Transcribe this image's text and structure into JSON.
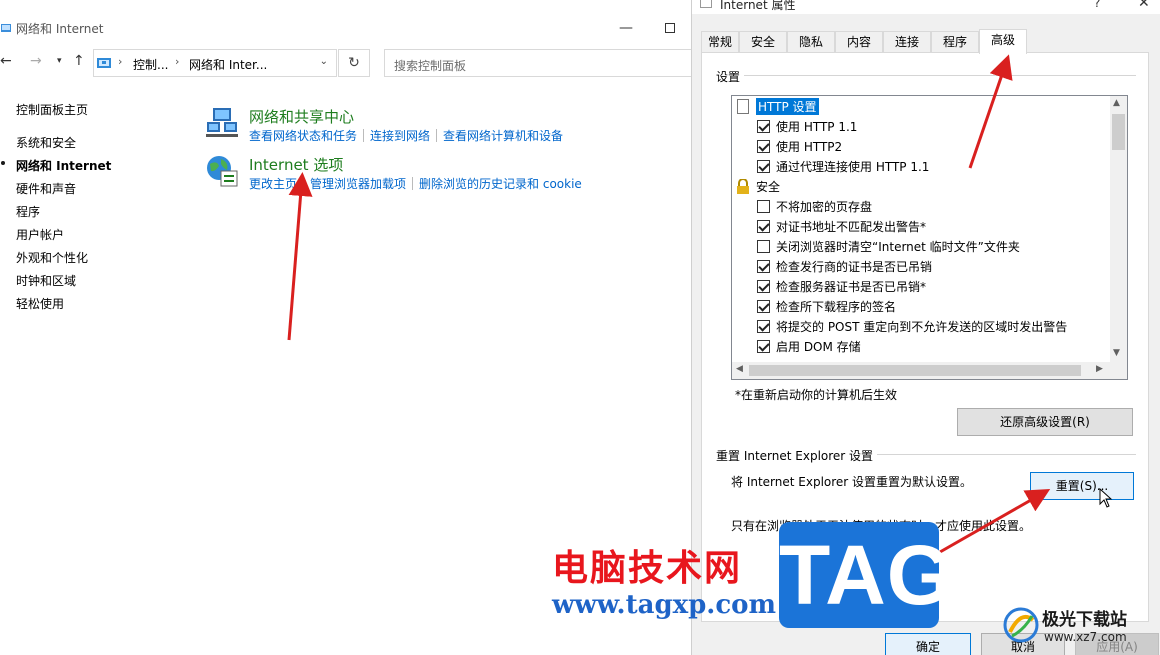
{
  "control_panel": {
    "window_title": "网络和 Internet",
    "address": {
      "crumb1": "控制...",
      "crumb2": "网络和 Inter...",
      "sep": "›"
    },
    "search_placeholder": "搜索控制面板",
    "sidebar": {
      "items": [
        {
          "label": "控制面板主页"
        },
        {
          "label": "系统和安全"
        },
        {
          "label": "网络和 Internet"
        },
        {
          "label": "硬件和声音"
        },
        {
          "label": "程序"
        },
        {
          "label": "用户帐户"
        },
        {
          "label": "外观和个性化"
        },
        {
          "label": "时钟和区域"
        },
        {
          "label": "轻松使用"
        }
      ]
    },
    "categories": [
      {
        "title": "网络和共享中心",
        "links": [
          "查看网络状态和任务",
          "连接到网络",
          "查看网络计算机和设备"
        ]
      },
      {
        "title": "Internet 选项",
        "links": [
          "更改主页",
          "管理浏览器加载项",
          "删除浏览的历史记录和 cookie"
        ]
      }
    ]
  },
  "dialog": {
    "title": "Internet 属性",
    "help_glyph": "?",
    "close_glyph": "✕",
    "tabs": [
      "常规",
      "安全",
      "隐私",
      "内容",
      "连接",
      "程序",
      "高级"
    ],
    "active_tab": "高级",
    "settings_label": "设置",
    "tree": [
      {
        "type": "group",
        "icon": "document-icon",
        "label": "HTTP 设置"
      },
      {
        "type": "check",
        "checked": true,
        "label": "使用 HTTP 1.1"
      },
      {
        "type": "check",
        "checked": true,
        "label": "使用 HTTP2"
      },
      {
        "type": "check",
        "checked": true,
        "label": "通过代理连接使用 HTTP 1.1"
      },
      {
        "type": "group",
        "icon": "lock-icon",
        "label": "安全"
      },
      {
        "type": "check",
        "checked": false,
        "label": "不将加密的页存盘"
      },
      {
        "type": "check",
        "checked": true,
        "label": "对证书地址不匹配发出警告*"
      },
      {
        "type": "check",
        "checked": false,
        "label": "关闭浏览器时清空“Internet 临时文件”文件夹"
      },
      {
        "type": "check",
        "checked": true,
        "label": "检查发行商的证书是否已吊销"
      },
      {
        "type": "check",
        "checked": true,
        "label": "检查服务器证书是否已吊销*"
      },
      {
        "type": "check",
        "checked": true,
        "label": "检查所下载程序的签名"
      },
      {
        "type": "check",
        "checked": true,
        "label": "将提交的 POST 重定向到不允许发送的区域时发出警告"
      },
      {
        "type": "check",
        "checked": true,
        "label": "启用 DOM 存储"
      }
    ],
    "restart_note": "*在重新启动你的计算机后生效",
    "restore_button": "还原高级设置(R)",
    "reset_group_label": "重置 Internet Explorer 设置",
    "reset_desc": "将 Internet Explorer 设置重置为默认设置。",
    "reset_button": "重置(S)...",
    "reset_warning": "只有在浏览器处于无法使用的状态时，才应使用此设置。",
    "ok_button": "确定",
    "cancel_button": "取消",
    "apply_button": "应用(A)"
  },
  "watermarks": {
    "cn_text": "电脑技术网",
    "url": "www.tagxp.com",
    "tag": "TAG",
    "xz_name": "极光下载站",
    "xz_url": "www.xz7.com"
  },
  "colors": {
    "accent": "#0078d7",
    "link": "#0066cc",
    "category_title": "#1e7d1e",
    "arrow": "#d9201f",
    "watermark_red": "#e8161d",
    "watermark_blue": "#1b74d8"
  }
}
